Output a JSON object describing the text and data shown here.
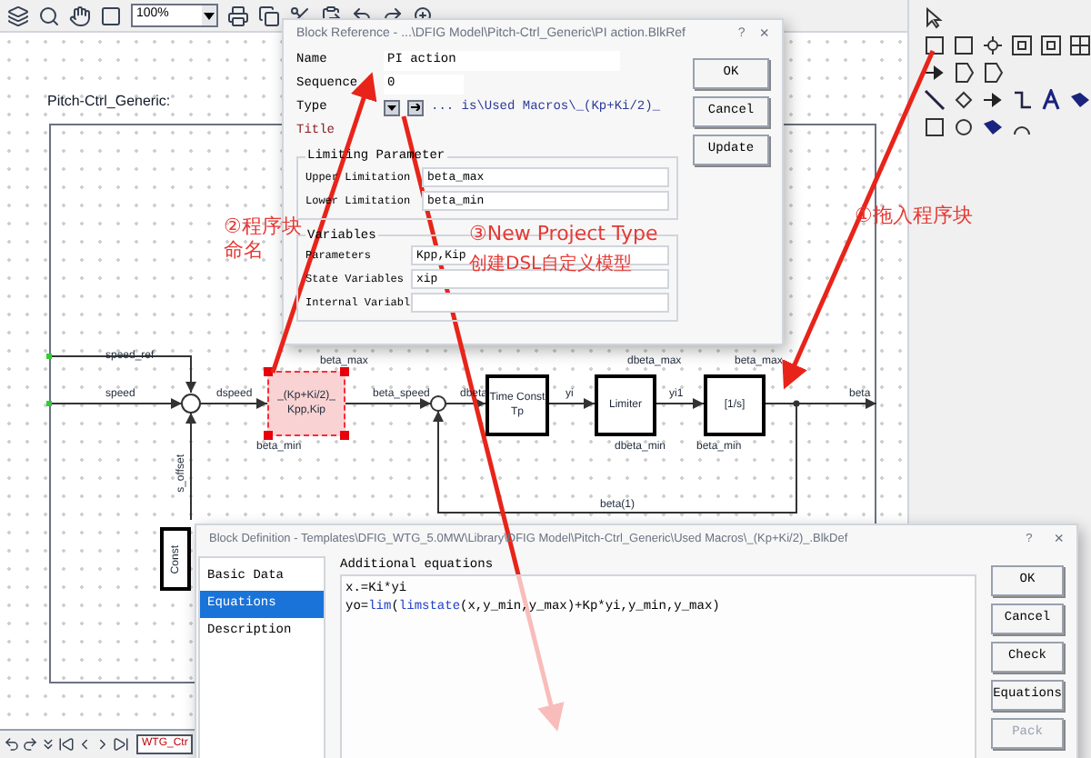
{
  "toolbar": {
    "zoom": "100%"
  },
  "diagram": {
    "title": "Pitch-Ctrl_Generic:",
    "blocks": [
      {
        "lines": [
          "_(Kp+Ki/2)_",
          "Kpp,Kip"
        ],
        "selected": true
      },
      {
        "lines": [
          "Time Const",
          "Tp"
        ],
        "selected": false
      },
      {
        "lines": [
          "Limiter"
        ],
        "selected": false
      },
      {
        "lines": [
          "[1/s]"
        ],
        "selected": false
      },
      {
        "lines": [
          "Const"
        ],
        "selected": false
      }
    ],
    "labels": [
      "speed_ref",
      "beta_max",
      "dbeta_max",
      "beta_max",
      "speed",
      "dspeed",
      "beta_speed",
      "dbeta",
      "yi",
      "yi1",
      "beta",
      "beta_min",
      "dbeta_min",
      "beta_min",
      "s_offset",
      "beta(1)"
    ]
  },
  "tab_bar": {
    "tabs": [
      {
        "label": "WTG_Ctr",
        "selected": true
      }
    ]
  },
  "block_reference": {
    "title": "Block Reference - ...\\DFIG Model\\Pitch-Ctrl_Generic\\PI action.BlkRef",
    "help": "?",
    "close": "×",
    "fields": [
      {
        "label": "Name",
        "value": "PI action"
      },
      {
        "label": "Sequence",
        "value": "0"
      }
    ],
    "type_label": "Type",
    "type_path": "... is\\Used Macros\\_(Kp+Ki/2)_",
    "title_label": "Title",
    "groups": [
      {
        "title": "Limiting Parameter",
        "fields": [
          {
            "label": "Upper Limitation",
            "value": "beta_max"
          },
          {
            "label": "Lower Limitation",
            "value": "beta_min"
          }
        ]
      },
      {
        "title": "Variables",
        "fields": [
          {
            "label": "Parameters",
            "value": "Kpp,Kip"
          },
          {
            "label": "State Variables",
            "value": "xip"
          },
          {
            "label": "Internal Variabl"
          }
        ]
      }
    ],
    "buttons": [
      "OK",
      "Cancel",
      "Update"
    ]
  },
  "block_definition": {
    "title": "Block Definition - Templates\\DFIG_WTG_5.0MW\\Library\\DFIG Model\\Pitch-Ctrl_Generic\\Used Macros\\_(Kp+Ki/2)_.BlkDef",
    "help": "?",
    "close": "×",
    "pages": [
      {
        "label": "Basic Data",
        "selected": false
      },
      {
        "label": "Equations",
        "selected": true
      },
      {
        "label": "Description",
        "selected": false
      }
    ],
    "editor_label": "Additional equations",
    "equations": [
      {
        "segments": [
          {
            "kind": "text",
            "text": "x.=Ki*yi"
          }
        ]
      },
      {
        "segments": [
          {
            "kind": "text",
            "text": "yo="
          },
          {
            "kind": "keyword",
            "text": "lim"
          },
          {
            "kind": "text",
            "text": "("
          },
          {
            "kind": "keyword",
            "text": "limstate"
          },
          {
            "kind": "text",
            "text": "(x,y_min,y_max)+Kp*yi,y_min,y_max)"
          }
        ]
      }
    ],
    "buttons": [
      {
        "label": "OK",
        "disabled": false
      },
      {
        "label": "Cancel",
        "disabled": false
      },
      {
        "label": "Check",
        "disabled": false
      },
      {
        "label": "Equations",
        "disabled": false
      },
      {
        "label": "Pack",
        "disabled": true
      }
    ]
  },
  "annotations": [
    {
      "text": "②程序块命名"
    },
    {
      "text": "③New Project Type"
    },
    {
      "text": "创建DSL自定义模型"
    },
    {
      "text": "①拖入程序块"
    }
  ]
}
